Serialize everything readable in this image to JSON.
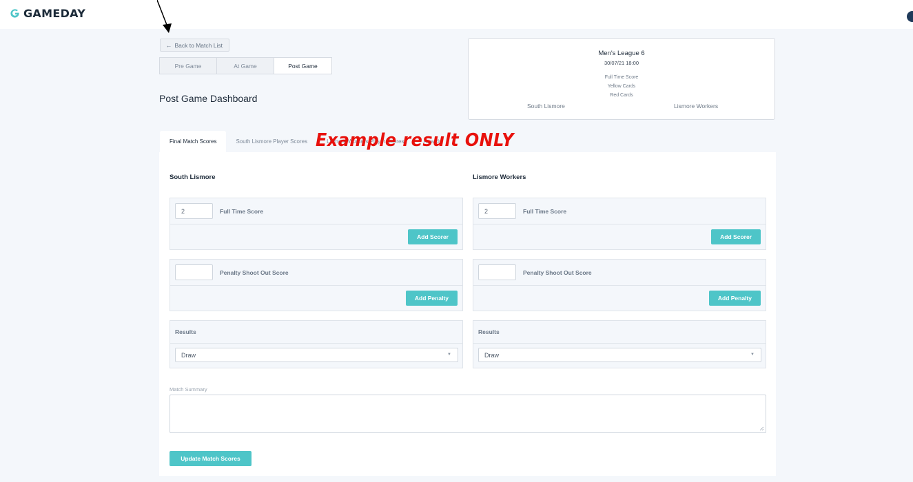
{
  "brand": {
    "name": "GAMEDAY",
    "accent_color": "#4ec5c8",
    "annotation_color": "#e8110c"
  },
  "nav": {
    "back_label": "Back to Match List",
    "back_icon": "arrow-left-icon",
    "phase_tabs": [
      {
        "label": "Pre Game",
        "active": false
      },
      {
        "label": "At Game",
        "active": false
      },
      {
        "label": "Post Game",
        "active": true
      }
    ]
  },
  "page": {
    "title": "Post Game Dashboard"
  },
  "match": {
    "league": "Men's League 6",
    "datetime": "30/07/21 18:00",
    "stat_labels": [
      "Full Time Score",
      "Yellow Cards",
      "Red Cards"
    ],
    "home_team": "South Lismore",
    "away_team": "Lismore Workers"
  },
  "content_tabs": [
    {
      "label": "Final Match Scores",
      "active": true
    },
    {
      "label": "South Lismore Player Scores",
      "active": false
    },
    {
      "label": "Lismore Workers Player Scores",
      "active": false
    },
    {
      "label": "Awards",
      "active": false
    }
  ],
  "annotation": {
    "text": "Example result ONLY"
  },
  "teams": {
    "home": {
      "name": "South Lismore",
      "full_time_score": "2",
      "full_time_label": "Full Time Score",
      "add_scorer_label": "Add Scorer",
      "penalty_score": "",
      "penalty_label": "Penalty Shoot Out Score",
      "add_penalty_label": "Add Penalty",
      "results_label": "Results",
      "result_value": "Draw"
    },
    "away": {
      "name": "Lismore Workers",
      "full_time_score": "2",
      "full_time_label": "Full Time Score",
      "add_scorer_label": "Add Scorer",
      "penalty_score": "",
      "penalty_label": "Penalty Shoot Out Score",
      "add_penalty_label": "Add Penalty",
      "results_label": "Results",
      "result_value": "Draw"
    }
  },
  "summary": {
    "label": "Match Summary",
    "value": ""
  },
  "update_label": "Update Match Scores"
}
